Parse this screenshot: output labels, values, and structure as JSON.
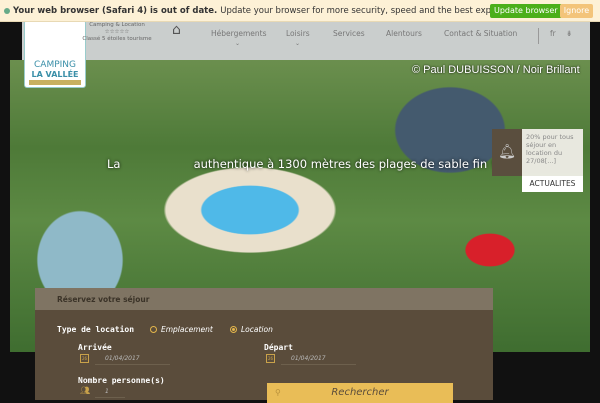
{
  "browser_warning": {
    "bold": "Your web browser (Safari 4) is out of date.",
    "text": "Update your browser for more security, speed and the best experience on this site.",
    "update_label": "Update browser",
    "ignore_label": "Ignore"
  },
  "logo": {
    "line1": "CAMPING",
    "line2": "LA VALLÉE"
  },
  "tagline": {
    "line1": "Camping & Location",
    "stars": "☆☆☆☆☆",
    "line2": "Classé 5 étoiles tourisme"
  },
  "nav": {
    "items": [
      "Hébergements",
      "Loisirs",
      "Services",
      "Alentours",
      "Contact & Situation"
    ],
    "lang": "fr"
  },
  "hero": {
    "credit": "© Paul DUBUISSON / Noir Brillant",
    "headline": "La                    authentique à 1300 mètres des plages de sable fin !"
  },
  "news": {
    "text": "20% pour tous séjour en location du 27/08[...]",
    "button": "ACTUALITES"
  },
  "booking": {
    "title": "Réservez votre séjour",
    "type_label": "Type de location",
    "options": [
      "Emplacement",
      "Location"
    ],
    "selected": "Location",
    "arrival_label": "Arrivée",
    "arrival_value": "01/04/2017",
    "departure_label": "Départ",
    "departure_value": "01/04/2017",
    "persons_label": "Nombre personne(s)",
    "persons_value": "1",
    "search_label": "Rechercher"
  }
}
